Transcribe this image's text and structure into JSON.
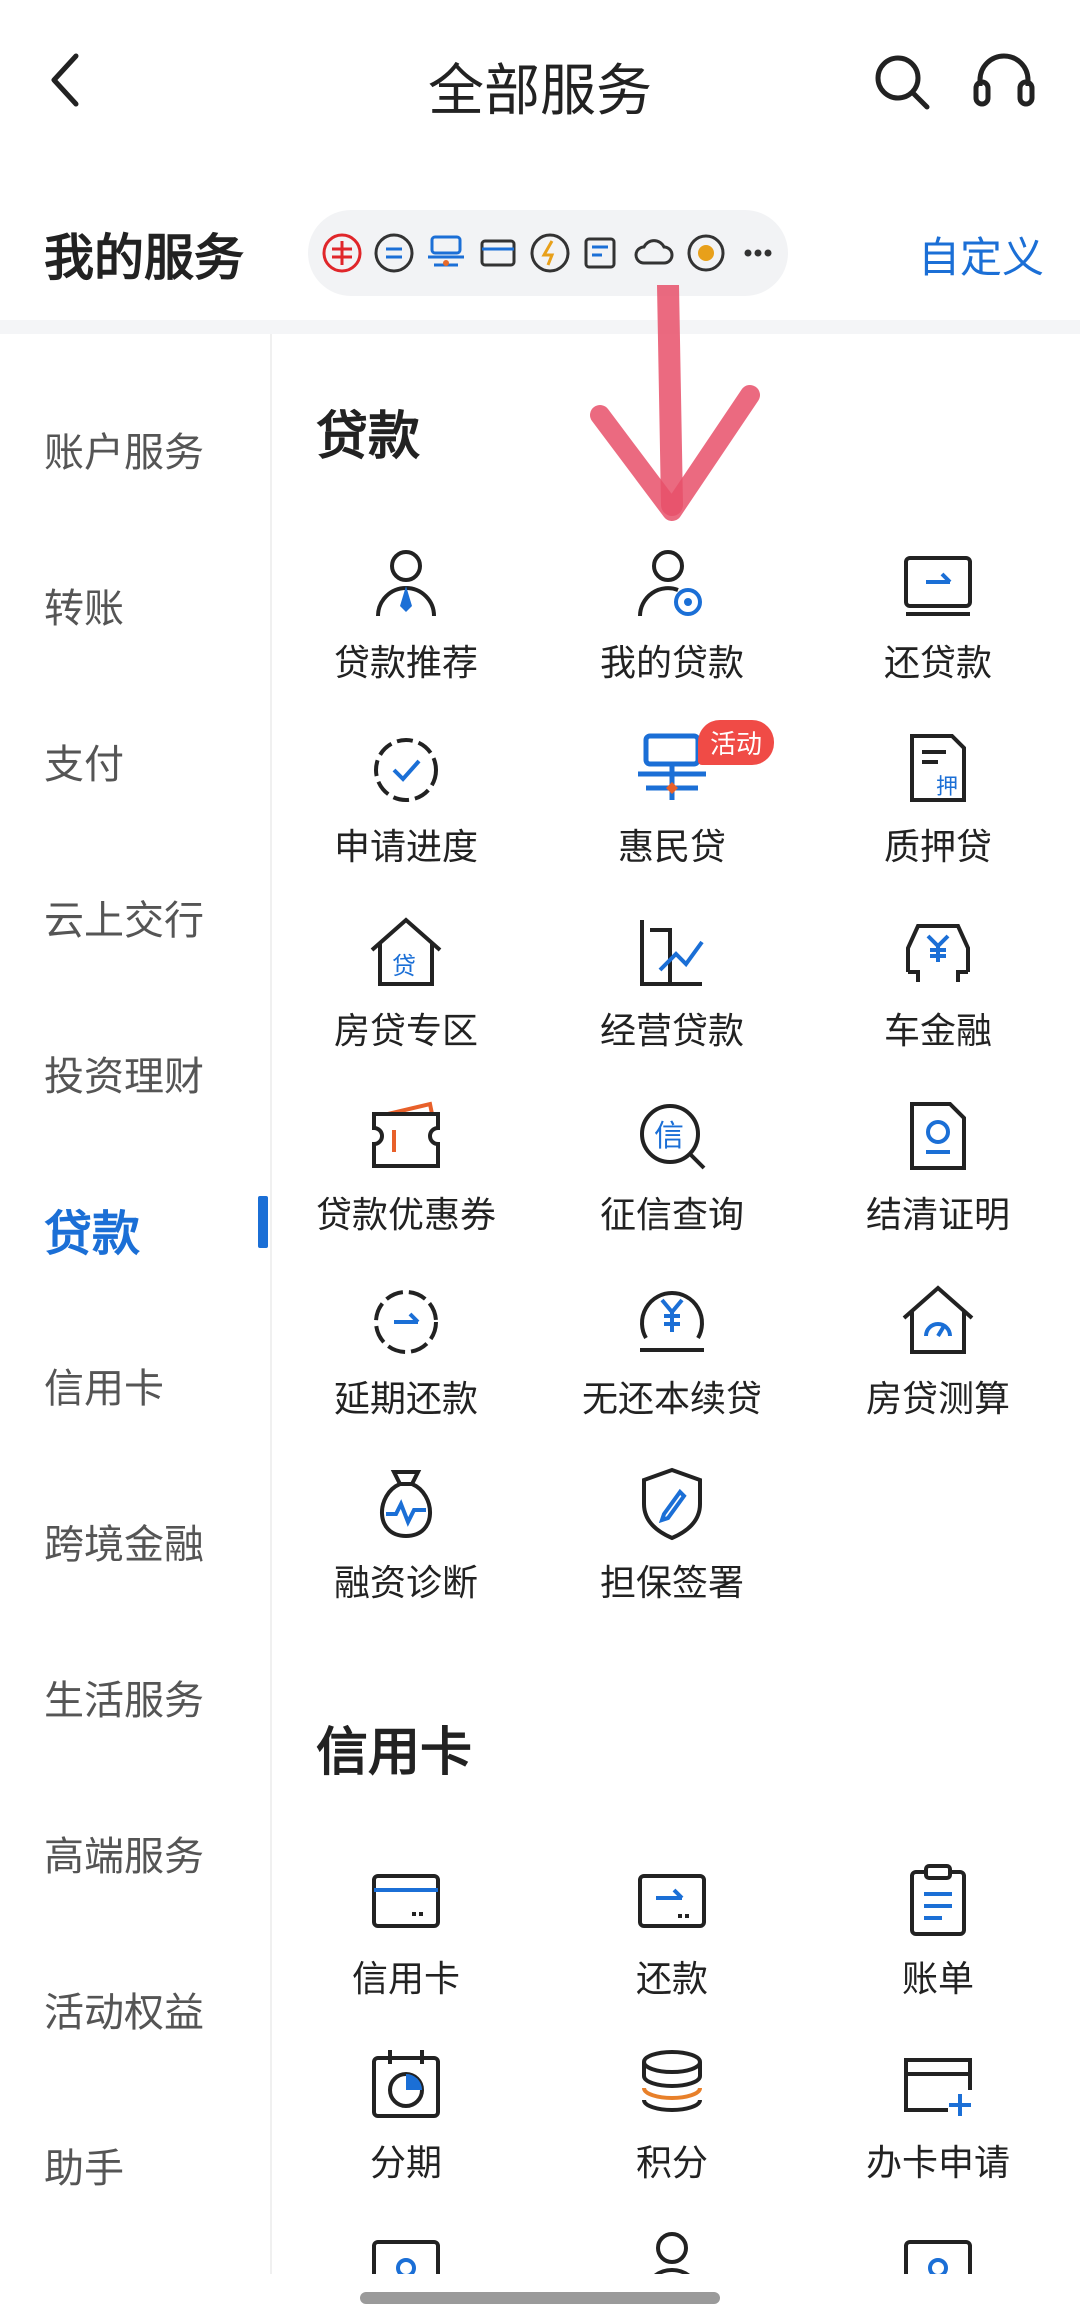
{
  "header": {
    "title": "全部服务"
  },
  "my_services": {
    "title": "我的服务",
    "customize": "自定义",
    "icons": [
      "bank-icon",
      "exchange-icon",
      "huimin-icon",
      "card-icon",
      "lightning-icon",
      "bill-icon",
      "cloud-icon",
      "new-icon",
      "more-icon"
    ]
  },
  "left_nav": {
    "items": [
      {
        "label": "账户服务"
      },
      {
        "label": "转账"
      },
      {
        "label": "支付"
      },
      {
        "label": "云上交行"
      },
      {
        "label": "投资理财"
      },
      {
        "label": "贷款"
      },
      {
        "label": "信用卡"
      },
      {
        "label": "跨境金融"
      },
      {
        "label": "生活服务"
      },
      {
        "label": "高端服务"
      },
      {
        "label": "活动权益"
      },
      {
        "label": "助手"
      }
    ],
    "active": "贷款"
  },
  "loan": {
    "title": "贷款",
    "items": [
      {
        "label": "贷款推荐"
      },
      {
        "label": "我的贷款"
      },
      {
        "label": "还贷款"
      },
      {
        "label": "申请进度"
      },
      {
        "label": "惠民贷",
        "badge": "活动"
      },
      {
        "label": "质押贷"
      },
      {
        "label": "房贷专区"
      },
      {
        "label": "经营贷款"
      },
      {
        "label": "车金融"
      },
      {
        "label": "贷款优惠券"
      },
      {
        "label": "征信查询"
      },
      {
        "label": "结清证明"
      },
      {
        "label": "延期还款"
      },
      {
        "label": "无还本续贷"
      },
      {
        "label": "房贷测算"
      },
      {
        "label": "融资诊断"
      },
      {
        "label": "担保签署"
      }
    ]
  },
  "credit": {
    "title": "信用卡",
    "items": [
      {
        "label": "信用卡"
      },
      {
        "label": "还款"
      },
      {
        "label": "账单"
      },
      {
        "label": "分期"
      },
      {
        "label": "积分"
      },
      {
        "label": "办卡申请"
      }
    ]
  },
  "colors": {
    "accent": "#1b6fd6",
    "badge": "#f04b46",
    "arrow": "#e8506a"
  }
}
